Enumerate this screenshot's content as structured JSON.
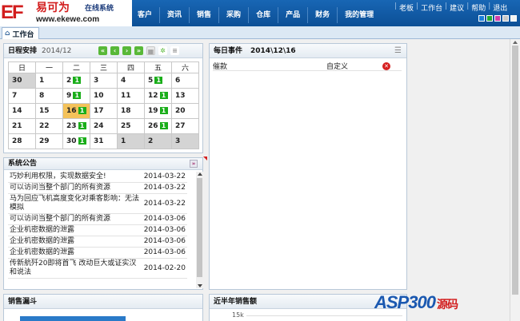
{
  "header": {
    "logo_mark": "EF",
    "logo_name": "易可为",
    "logo_suffix": "在线系统",
    "logo_url": "www.ekewe.com",
    "nav": [
      "客户",
      "资讯",
      "销售",
      "采购",
      "仓库",
      "产品",
      "财务",
      "我的管理"
    ],
    "util": [
      "老板",
      "工作台",
      "建议",
      "帮助",
      "退出"
    ],
    "skin_colors": [
      "#1a7ed8",
      "#22a832",
      "#d33ca8",
      "#c8c8c8",
      "#f2f2f2"
    ]
  },
  "tabbar": {
    "home": "工作台"
  },
  "calendar": {
    "title": "日程安排",
    "month": "2014/12",
    "tool_icons": [
      "first-page-icon",
      "prev-icon",
      "next-icon",
      "last-page-icon",
      "calendar-icon",
      "settings-icon",
      "list-icon"
    ],
    "weekdays": [
      "日",
      "一",
      "二",
      "三",
      "四",
      "五",
      "六"
    ],
    "weeks": [
      [
        {
          "d": "30",
          "o": true
        },
        {
          "d": "1"
        },
        {
          "d": "2",
          "e": "1"
        },
        {
          "d": "3"
        },
        {
          "d": "4"
        },
        {
          "d": "5",
          "e": "1"
        },
        {
          "d": "6"
        }
      ],
      [
        {
          "d": "7"
        },
        {
          "d": "8"
        },
        {
          "d": "9",
          "e": "1"
        },
        {
          "d": "10"
        },
        {
          "d": "11"
        },
        {
          "d": "12",
          "e": "1"
        },
        {
          "d": "13"
        }
      ],
      [
        {
          "d": "14"
        },
        {
          "d": "15"
        },
        {
          "d": "16",
          "e": "1",
          "t": true
        },
        {
          "d": "17"
        },
        {
          "d": "18"
        },
        {
          "d": "19",
          "e": "1"
        },
        {
          "d": "20"
        }
      ],
      [
        {
          "d": "21"
        },
        {
          "d": "22"
        },
        {
          "d": "23",
          "e": "1"
        },
        {
          "d": "24"
        },
        {
          "d": "25"
        },
        {
          "d": "26",
          "e": "1"
        },
        {
          "d": "27"
        }
      ],
      [
        {
          "d": "28"
        },
        {
          "d": "29"
        },
        {
          "d": "30",
          "e": "1"
        },
        {
          "d": "31"
        },
        {
          "d": "1",
          "o": true
        },
        {
          "d": "2",
          "o": true
        },
        {
          "d": "3",
          "o": true
        }
      ]
    ]
  },
  "events": {
    "title": "每日事件",
    "date": "2014\\12\\16",
    "rows": [
      {
        "name": "催款",
        "type": "自定义"
      }
    ]
  },
  "announcements": {
    "title": "系统公告",
    "rows": [
      {
        "text": "巧妙利用权限，实现数据安全!",
        "date": "2014-03-22"
      },
      {
        "text": "可以访问当整个部门的所有资源",
        "date": "2014-03-22"
      },
      {
        "text": "马为回应飞机高度变化对乘客影响：无法模拟",
        "date": "2014-03-22"
      },
      {
        "text": "可以访问当整个部门的所有资源",
        "date": "2014-03-06"
      },
      {
        "text": "企业机密数据的泄露",
        "date": "2014-03-06"
      },
      {
        "text": "企业机密数据的泄露",
        "date": "2014-03-06"
      },
      {
        "text": "企业机密数据的泄露",
        "date": "2014-03-06"
      },
      {
        "text": "传新航歼20即将首飞 改动巨大或证实汉和说法",
        "date": "2014-02-20"
      }
    ]
  },
  "funnel": {
    "title": "销售漏斗"
  },
  "sales": {
    "title": "近半年销售额",
    "tick": "15k"
  },
  "watermark": {
    "brand": "ASP300",
    "suffix": "源码"
  }
}
